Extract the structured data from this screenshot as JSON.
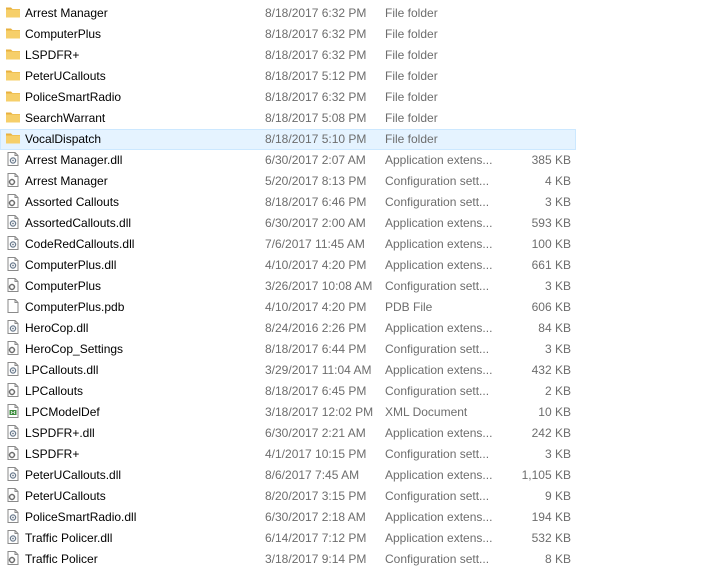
{
  "window": {
    "view": "details"
  },
  "colors": {
    "selection_background": "#e5f3ff",
    "selection_border": "#cce8ff",
    "folder": "#f4c55a",
    "secondary_text": "#6d6d6d"
  },
  "files": [
    {
      "name": "Arrest Manager",
      "date": "8/18/2017 6:32 PM",
      "type": "File folder",
      "size": "",
      "icon": "folder-icon"
    },
    {
      "name": "ComputerPlus",
      "date": "8/18/2017 6:32 PM",
      "type": "File folder",
      "size": "",
      "icon": "folder-icon"
    },
    {
      "name": "LSPDFR+",
      "date": "8/18/2017 6:32 PM",
      "type": "File folder",
      "size": "",
      "icon": "folder-icon"
    },
    {
      "name": "PeterUCallouts",
      "date": "8/18/2017 5:12 PM",
      "type": "File folder",
      "size": "",
      "icon": "folder-icon"
    },
    {
      "name": "PoliceSmartRadio",
      "date": "8/18/2017 6:32 PM",
      "type": "File folder",
      "size": "",
      "icon": "folder-icon"
    },
    {
      "name": "SearchWarrant",
      "date": "8/18/2017 5:08 PM",
      "type": "File folder",
      "size": "",
      "icon": "folder-icon"
    },
    {
      "name": "VocalDispatch",
      "date": "8/18/2017 5:10 PM",
      "type": "File folder",
      "size": "",
      "icon": "folder-icon",
      "selected": true
    },
    {
      "name": "Arrest Manager.dll",
      "date": "6/30/2017 2:07 AM",
      "type": "Application extens...",
      "size": "385 KB",
      "icon": "dll-file-icon"
    },
    {
      "name": "Arrest Manager",
      "date": "5/20/2017 8:13 PM",
      "type": "Configuration sett...",
      "size": "4 KB",
      "icon": "config-file-icon"
    },
    {
      "name": "Assorted Callouts",
      "date": "8/18/2017 6:46 PM",
      "type": "Configuration sett...",
      "size": "3 KB",
      "icon": "config-file-icon"
    },
    {
      "name": "AssortedCallouts.dll",
      "date": "6/30/2017 2:00 AM",
      "type": "Application extens...",
      "size": "593 KB",
      "icon": "dll-file-icon"
    },
    {
      "name": "CodeRedCallouts.dll",
      "date": "7/6/2017 11:45 AM",
      "type": "Application extens...",
      "size": "100 KB",
      "icon": "dll-file-icon"
    },
    {
      "name": "ComputerPlus.dll",
      "date": "4/10/2017 4:20 PM",
      "type": "Application extens...",
      "size": "661 KB",
      "icon": "dll-file-icon"
    },
    {
      "name": "ComputerPlus",
      "date": "3/26/2017 10:08 AM",
      "type": "Configuration sett...",
      "size": "3 KB",
      "icon": "config-file-icon"
    },
    {
      "name": "ComputerPlus.pdb",
      "date": "4/10/2017 4:20 PM",
      "type": "PDB File",
      "size": "606 KB",
      "icon": "blank-file-icon"
    },
    {
      "name": "HeroCop.dll",
      "date": "8/24/2016 2:26 PM",
      "type": "Application extens...",
      "size": "84 KB",
      "icon": "dll-file-icon"
    },
    {
      "name": "HeroCop_Settings",
      "date": "8/18/2017 6:44 PM",
      "type": "Configuration sett...",
      "size": "3 KB",
      "icon": "config-file-icon"
    },
    {
      "name": "LPCallouts.dll",
      "date": "3/29/2017 11:04 AM",
      "type": "Application extens...",
      "size": "432 KB",
      "icon": "dll-file-icon"
    },
    {
      "name": "LPCallouts",
      "date": "8/18/2017 6:45 PM",
      "type": "Configuration sett...",
      "size": "2 KB",
      "icon": "config-file-icon"
    },
    {
      "name": "LPCModelDef",
      "date": "3/18/2017 12:02 PM",
      "type": "XML Document",
      "size": "10 KB",
      "icon": "xml-file-icon"
    },
    {
      "name": "LSPDFR+.dll",
      "date": "6/30/2017 2:21 AM",
      "type": "Application extens...",
      "size": "242 KB",
      "icon": "dll-file-icon"
    },
    {
      "name": "LSPDFR+",
      "date": "4/1/2017 10:15 PM",
      "type": "Configuration sett...",
      "size": "3 KB",
      "icon": "config-file-icon"
    },
    {
      "name": "PeterUCallouts.dll",
      "date": "8/6/2017 7:45 AM",
      "type": "Application extens...",
      "size": "1,105 KB",
      "icon": "dll-file-icon"
    },
    {
      "name": "PeterUCallouts",
      "date": "8/20/2017 3:15 PM",
      "type": "Configuration sett...",
      "size": "9 KB",
      "icon": "config-file-icon"
    },
    {
      "name": "PoliceSmartRadio.dll",
      "date": "6/30/2017 2:18 AM",
      "type": "Application extens...",
      "size": "194 KB",
      "icon": "dll-file-icon"
    },
    {
      "name": "Traffic Policer.dll",
      "date": "6/14/2017 7:12 PM",
      "type": "Application extens...",
      "size": "532 KB",
      "icon": "dll-file-icon"
    },
    {
      "name": "Traffic Policer",
      "date": "3/18/2017 9:14 PM",
      "type": "Configuration sett...",
      "size": "8 KB",
      "icon": "config-file-icon"
    }
  ]
}
